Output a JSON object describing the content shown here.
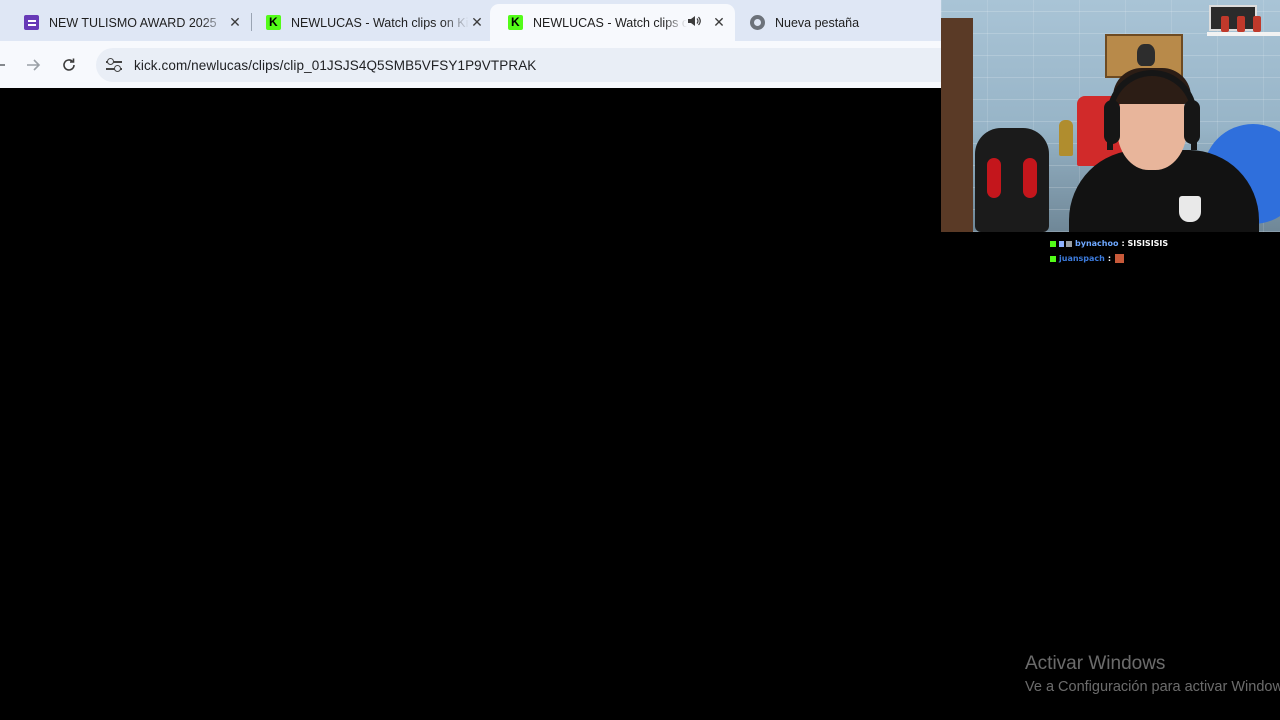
{
  "browser": {
    "tabs": [
      {
        "title": "NEW TULISMO AWARD 2025",
        "icon": "forms-icon"
      },
      {
        "title": "NEWLUCAS - Watch clips on Kick",
        "icon": "kick-icon"
      },
      {
        "title": "NEWLUCAS - Watch clips on Kick",
        "icon": "kick-icon",
        "active": true,
        "audio": "speaker-icon"
      },
      {
        "title": "Nueva pestaña",
        "icon": "chrome-icon"
      }
    ],
    "url": "kick.com/newlucas/clips/clip_01JSJS4Q5SMB5VFSY1P9VTPRAK",
    "kick_letter": "K",
    "close_glyph": "✕",
    "icons": {
      "back": "back-arrow-icon",
      "forward": "forward-arrow-icon",
      "reload": "reload-icon",
      "site_info": "tune-icon"
    }
  },
  "stream_chat": [
    {
      "user": "bynachoo",
      "message": ": SISISISIS"
    },
    {
      "user": "juanspach",
      "message": ":"
    }
  ],
  "watermark": {
    "title": "Activar Windows",
    "subtitle": "Ve a Configuración para activar Windows."
  },
  "colors": {
    "kick_green": "#53fc18",
    "forms_purple": "#673ab7",
    "page_background": "#000000"
  }
}
